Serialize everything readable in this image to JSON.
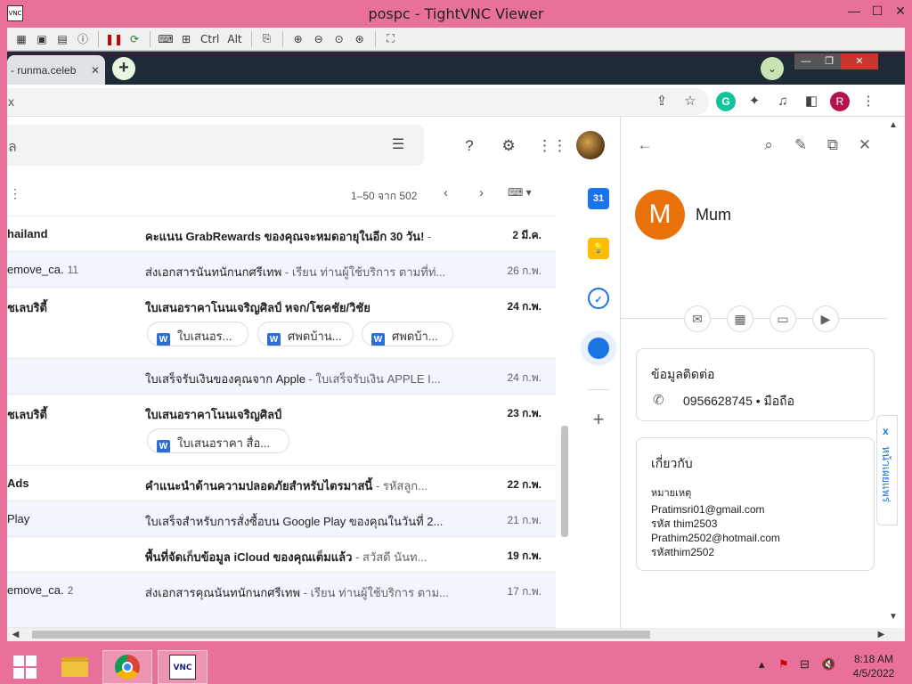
{
  "vnc": {
    "title": "pospc - TightVNC Viewer",
    "app_icon_text": "VNC",
    "minimize": "—",
    "maximize": "☐",
    "close": "✕",
    "toolbar": {
      "ctrl_label": "Ctrl",
      "alt_label": "Alt"
    }
  },
  "chrome": {
    "tab_title": "- runma.celeb",
    "tab_close": "✕",
    "new_tab": "+",
    "tab_search": "⌄",
    "omnibox_text": "x",
    "profile_initial": "R",
    "grammarly_letter": "G"
  },
  "gmail": {
    "search_placeholder": "ล",
    "toolbar_more": "⋮",
    "range_text": "1–50 จาก 502",
    "prev": "‹",
    "next": "›",
    "emails": [
      {
        "sender": "hailand",
        "count": "",
        "subject": "คะแนน GrabRewards ของคุณจะหมดอายุในอีก 30 วัน!",
        "snippet": " -",
        "date": "2 มี.ค.",
        "unread": true,
        "attachments": []
      },
      {
        "sender": "emove_ca.",
        "count": "11",
        "subject": "ส่งเอกสารนันทนักนกศรีเทพ",
        "snippet": " - เรียน ท่านผู้ใช้บริการ ตามที่ท่...",
        "date": "26 ก.พ.",
        "unread": false,
        "attachments": []
      },
      {
        "sender": "ชเลบริตี้",
        "count": "",
        "subject": "ใบเสนอราคาโนนเจริญศิลป์ หจก/โชคชัย/วิชัย",
        "snippet": "",
        "date": "24 ก.พ.",
        "unread": true,
        "attachments": [
          "ใบเสนอร...",
          "ศพดบ้าน...",
          "ศพดบ้า..."
        ]
      },
      {
        "sender": "",
        "count": "",
        "subject": "ใบเสร็จรับเงินของคุณจาก Apple",
        "snippet": " - ใบเสร็จรับเงิน APPLE I...",
        "date": "24 ก.พ.",
        "unread": false,
        "attachments": []
      },
      {
        "sender": "ชเลบริตี้",
        "count": "",
        "subject": "ใบเสนอราคาโนนเจริญศิลป์",
        "snippet": "",
        "date": "23 ก.พ.",
        "unread": true,
        "attachments": [
          "ใบเสนอราคา สื่อ..."
        ]
      },
      {
        "sender": "Ads",
        "count": "",
        "subject": "คำแนะนำด้านความปลอดภัยสำหรับไตรมาสนี้",
        "snippet": " - รหัสลูก...",
        "date": "22 ก.พ.",
        "unread": true,
        "attachments": []
      },
      {
        "sender": "Play",
        "count": "",
        "subject": "ใบเสร็จสำหรับการสั่งซื้อบน Google Play ของคุณในวันที่ 2...",
        "snippet": "",
        "date": "21 ก.พ.",
        "unread": false,
        "attachments": []
      },
      {
        "sender": "",
        "count": "",
        "subject": "พื้นที่จัดเก็บข้อมูล iCloud ของคุณเต็มแล้ว",
        "snippet": " - สวัสดี นันท...",
        "date": "19 ก.พ.",
        "unread": true,
        "attachments": []
      },
      {
        "sender": "emove_ca.",
        "count": "2",
        "subject": "ส่งเอกสารคุณนันทนักนกศรีเทพ",
        "snippet": " - เรียน ท่านผู้ใช้บริการ ตาม...",
        "date": "17 ก.พ.",
        "unread": false,
        "attachments": []
      }
    ],
    "side_add": "+"
  },
  "contact": {
    "initial": "M",
    "name": "Mum",
    "info_title": "ข้อมูลติดต่อ",
    "phone": "0956628745 • มือถือ",
    "about_title": "เกี่ยวกับ",
    "notes_label": "หมายเหตุ",
    "notes": "Pratimsri01@gmail.com\nรหัส thim2503\nPrathim2502@hotmail.com\nรหัสthim2502",
    "side_tab_close": "x",
    "side_tab_text": "หน้าเผยแพร่"
  },
  "taskbar": {
    "time": "8:18 AM",
    "date": "4/5/2022",
    "vnc_label": "VNC"
  }
}
